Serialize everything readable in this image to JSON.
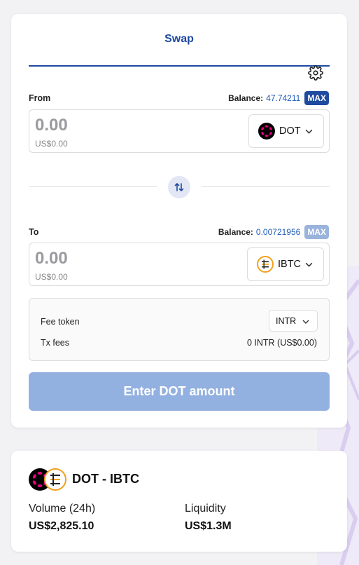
{
  "swap": {
    "tab_label": "Swap",
    "from": {
      "label": "From",
      "balance_label": "Balance:",
      "balance_value": "47.74211",
      "max_label": "MAX",
      "amount": "0.00",
      "usd": "US$0.00",
      "token": "DOT",
      "token_icon": "polkadot-icon"
    },
    "to": {
      "label": "To",
      "balance_label": "Balance:",
      "balance_value": "0.00721956",
      "max_label": "MAX",
      "amount": "0.00",
      "usd": "US$0.00",
      "token": "IBTC",
      "token_icon": "ibtc-icon"
    },
    "fees": {
      "fee_token_label": "Fee token",
      "fee_token_value": "INTR",
      "tx_fees_label": "Tx fees",
      "tx_fees_value": "0 INTR (US$0.00)"
    },
    "submit_label": "Enter DOT amount"
  },
  "pool": {
    "pair": "DOT - IBTC",
    "volume_label": "Volume (24h)",
    "volume_value": "US$2,825.10",
    "liquidity_label": "Liquidity",
    "liquidity_value": "US$1.3M"
  },
  "colors": {
    "accent": "#1e4aa0",
    "balance_value": "#1e5bb8",
    "button_disabled": "#93b1e0",
    "ibtc_orange": "#f2a11f"
  }
}
